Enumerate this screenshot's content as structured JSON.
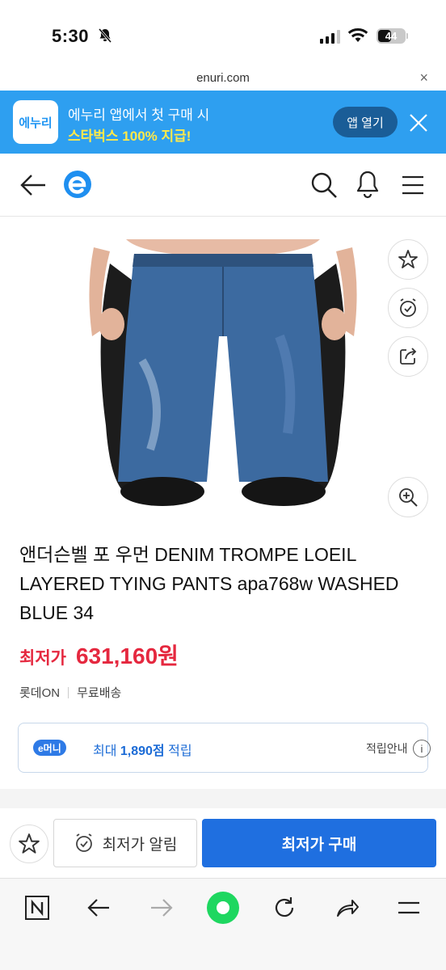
{
  "status_bar": {
    "time": "5:30",
    "battery": "44"
  },
  "browser": {
    "url": "enuri.com",
    "close_label": "×"
  },
  "app_banner": {
    "logo_text": "에누리",
    "line1": "에누리 앱에서 첫 구매 시",
    "line2": "스타벅스 100% 지급!",
    "open_label": "앱 열기"
  },
  "product": {
    "title": "앤더슨벨 포 우먼 DENIM TROMPE LOEIL LAYERED TYING PANTS apa768w WASHED BLUE 34",
    "price_label": "최저가",
    "price_value": "631,160원",
    "seller": "롯데ON",
    "shipping": "무료배송"
  },
  "emoney": {
    "badge": "e머니",
    "prefix": "최대 ",
    "amount": "1,890점",
    "suffix": " 적립",
    "guide": "적립안내",
    "info_icon": "i"
  },
  "actions": {
    "alarm_label": "최저가 알림",
    "buy_label": "최저가 구매"
  },
  "colors": {
    "accent_blue": "#1f6fe0",
    "price_red": "#e5283f",
    "banner_blue": "#2e9ff0",
    "banner_yellow": "#ffe94a",
    "nav_green": "#1ed760"
  }
}
